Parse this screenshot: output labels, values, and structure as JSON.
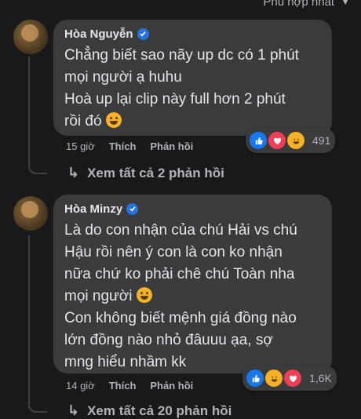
{
  "sort": {
    "label": "Phù hợp nhất"
  },
  "comments": [
    {
      "author": "Hòa Nguyễn",
      "lines": [
        "Chẳng biết sao nãy up dc có 1 phút",
        "mọi người ạ huhu",
        "Hoà up lại clip này full hơn 2 phút",
        "rồi đó"
      ],
      "time": "15 giờ",
      "like_label": "Thích",
      "reply_label": "Phản hồi",
      "reaction_count": "491",
      "view_replies": "Xem tất cả 2 phản hồi"
    },
    {
      "author": "Hòa Minzy",
      "lines": [
        "Là do con nhận của chú Hải vs chú",
        "Hậu rồi nên ý con là con ko nhận",
        "nữa chứ ko phải chê chú Toàn nha",
        "mọi người",
        "Con không biết mệnh giá đồng nào",
        "lớn đồng nào nhỏ đâuuu ạa, sợ",
        "mng hiểu nhầm kk"
      ],
      "time": "14 giờ",
      "like_label": "Thích",
      "reply_label": "Phản hồi",
      "reaction_count": "1,6K",
      "view_replies": "Xem tất cả 20 phản hồi"
    }
  ],
  "icons": {
    "verified": "verified-badge-icon",
    "like": "like-reaction-icon",
    "love": "love-reaction-icon",
    "haha": "haha-reaction-icon",
    "reply_arrow": "reply-arrow-icon"
  },
  "colors": {
    "background": "#18191a",
    "bubble": "#3a3b3c",
    "verified": "#2374e1"
  }
}
